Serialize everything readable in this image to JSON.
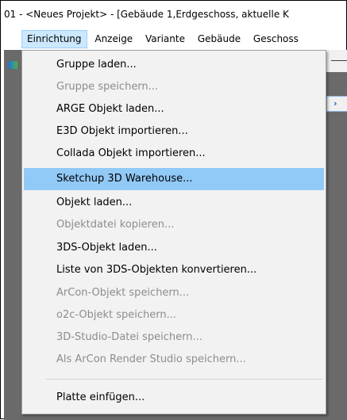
{
  "window": {
    "title": "01 - <Neues Projekt> - [Gebäude 1,Erdgeschoss, aktuelle K"
  },
  "menubar": {
    "items": [
      {
        "label": "Einrichtung"
      },
      {
        "label": "Anzeige"
      },
      {
        "label": "Variante"
      },
      {
        "label": "Gebäude"
      },
      {
        "label": "Geschoss"
      }
    ]
  },
  "menu": {
    "items": [
      {
        "label": "Gruppe laden...",
        "enabled": true
      },
      {
        "label": "Gruppe speichern...",
        "enabled": false
      },
      {
        "label": "ARGE Objekt laden...",
        "enabled": true
      },
      {
        "label": "E3D Objekt importieren...",
        "enabled": true
      },
      {
        "label": "Collada Objekt importieren...",
        "enabled": true
      },
      {
        "label": "Sketchup 3D Warehouse...",
        "enabled": true,
        "highlighted": true
      },
      {
        "label": "Objekt laden...",
        "enabled": true
      },
      {
        "label": "Objektdatei kopieren...",
        "enabled": false
      },
      {
        "label": "3DS-Objekt laden...",
        "enabled": true
      },
      {
        "label": "Liste von 3DS-Objekten konvertieren...",
        "enabled": true
      },
      {
        "label": "ArCon-Objekt speichern...",
        "enabled": false
      },
      {
        "label": "o2c-Objekt speichern...",
        "enabled": false
      },
      {
        "label": "3D-Studio-Datei speichern...",
        "enabled": false
      },
      {
        "label": "Als ArCon Render Studio speichern...",
        "enabled": false
      },
      {
        "label": "Platte einfügen...",
        "enabled": true
      }
    ]
  },
  "colors": {
    "highlight": "#91c9f7",
    "disabled_text": "#8d8d8d",
    "menu_bg": "#f2f2f2",
    "workspace": "#6a6a6a"
  }
}
